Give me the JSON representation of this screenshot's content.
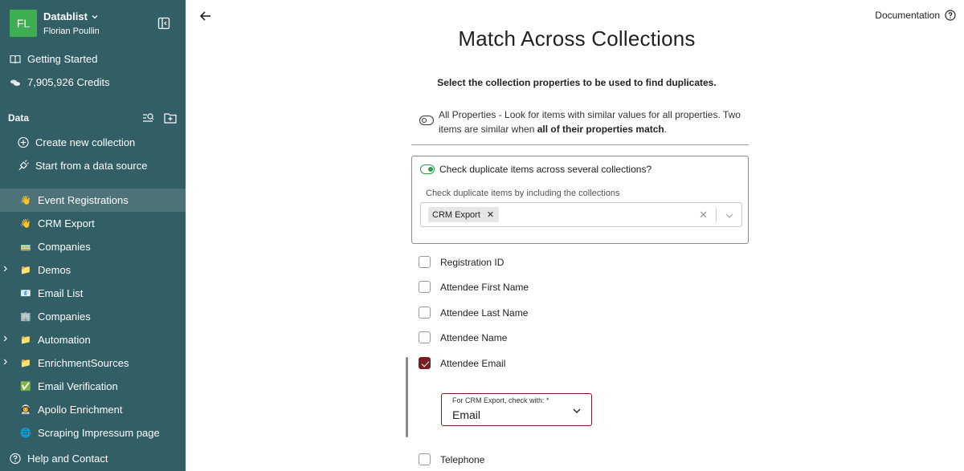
{
  "workspace": {
    "initials": "FL",
    "name": "Datablist",
    "user": "Florian Poullin"
  },
  "sidebar": {
    "getting_started": "Getting Started",
    "credits": "7,905,926 Credits",
    "data_heading": "Data",
    "create_collection": "Create new collection",
    "start_from_source": "Start from a data source",
    "collections": [
      {
        "label": "Event Registrations",
        "emoji": "👋",
        "active": true,
        "expandable": false
      },
      {
        "label": "CRM Export",
        "emoji": "👋",
        "active": false,
        "expandable": false
      },
      {
        "label": "Companies",
        "emoji": "🚃",
        "active": false,
        "expandable": false
      },
      {
        "label": "Demos",
        "emoji": "📁",
        "active": false,
        "expandable": true
      },
      {
        "label": "Email List",
        "emoji": "📧",
        "active": false,
        "expandable": false
      },
      {
        "label": "Companies",
        "emoji": "🏢",
        "active": false,
        "expandable": false
      },
      {
        "label": "Automation",
        "emoji": "📁",
        "active": false,
        "expandable": true
      },
      {
        "label": "EnrichmentSources",
        "emoji": "📁",
        "active": false,
        "expandable": true
      },
      {
        "label": "Email Verification",
        "emoji": "✅",
        "active": false,
        "expandable": false
      },
      {
        "label": "Apollo Enrichment",
        "emoji": "👨‍🚀",
        "active": false,
        "expandable": false
      },
      {
        "label": "Scraping Impressum page",
        "emoji": "🌐",
        "active": false,
        "expandable": false
      }
    ],
    "help": "Help and Contact"
  },
  "header": {
    "documentation": "Documentation"
  },
  "main": {
    "title": "Match Across Collections",
    "subtitle": "Select the collection properties to be used to find duplicates.",
    "all_properties": {
      "text": "All Properties - Look for items with similar values for all properties. Two items are similar when ",
      "bold": "all of their properties match",
      "end": ".",
      "enabled": false
    },
    "cross_collection": {
      "question": "Check duplicate items across several collections?",
      "enabled": true,
      "hint": "Check duplicate items by including the collections",
      "selected": [
        "CRM Export"
      ]
    },
    "properties": [
      {
        "label": "Registration ID",
        "checked": false
      },
      {
        "label": "Attendee First Name",
        "checked": false
      },
      {
        "label": "Attendee Last Name",
        "checked": false
      },
      {
        "label": "Attendee Name",
        "checked": false
      },
      {
        "label": "Attendee Email",
        "checked": true
      },
      {
        "label": "Telephone",
        "checked": false
      }
    ],
    "match_select": {
      "label": "For CRM Export, check with: *",
      "value": "Email"
    }
  },
  "colors": {
    "sidebar": "#325e66",
    "active_item": "#4d7379",
    "accent": "#7a1c22",
    "toggle_on": "#2e9a4a",
    "avatar": "#3fae52"
  }
}
